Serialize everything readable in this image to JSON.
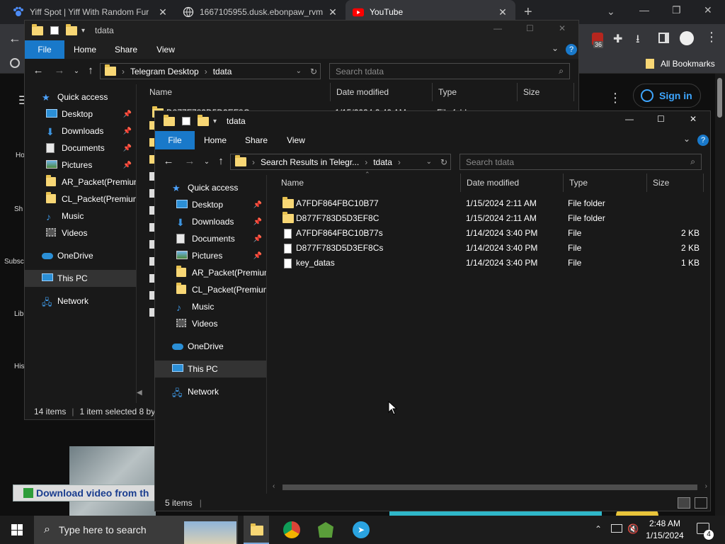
{
  "chrome": {
    "tabs": [
      {
        "title": "Yiff Spot | Yiff With Random Fur",
        "active": false
      },
      {
        "title": "1667105955.dusk.ebonpaw_rvm",
        "active": false
      },
      {
        "title": "YouTube",
        "active": true
      }
    ],
    "bookmarks_label": "All Bookmarks",
    "ext_badge": "36",
    "signin_label": "Sign in",
    "yt_sidebar": [
      "Ho",
      "Sh",
      "Subsc",
      "Lib",
      "His"
    ],
    "yt_banner": "Download video from th"
  },
  "back_explorer": {
    "title": "tdata",
    "ribbon": [
      "File",
      "Home",
      "Share",
      "View"
    ],
    "breadcrumb": [
      "Telegram Desktop",
      "tdata"
    ],
    "search_placeholder": "Search tdata",
    "columns": [
      "Name",
      "Date modified",
      "Type",
      "Size"
    ],
    "partial_row": {
      "name": "D877F783D5D3EF8C",
      "date": "1/15/2024 2:40 AM",
      "type": "File fold"
    },
    "nav": [
      {
        "label": "Quick access",
        "icon": "star"
      },
      {
        "label": "Desktop",
        "icon": "desktop",
        "pinned": true
      },
      {
        "label": "Downloads",
        "icon": "download",
        "pinned": true
      },
      {
        "label": "Documents",
        "icon": "documents",
        "pinned": true
      },
      {
        "label": "Pictures",
        "icon": "pictures",
        "pinned": true
      },
      {
        "label": "AR_Packet(Premium",
        "icon": "folder"
      },
      {
        "label": "CL_Packet(Premium",
        "icon": "folder"
      },
      {
        "label": "Music",
        "icon": "music"
      },
      {
        "label": "Videos",
        "icon": "videos"
      },
      {
        "label": "OneDrive",
        "icon": "cloud"
      },
      {
        "label": "This PC",
        "icon": "pc",
        "selected": true
      },
      {
        "label": "Network",
        "icon": "network"
      }
    ],
    "status": {
      "count": "14 items",
      "selected": "1 item selected  8 by"
    }
  },
  "front_explorer": {
    "title": "tdata",
    "ribbon": [
      "File",
      "Home",
      "Share",
      "View"
    ],
    "breadcrumb": [
      "Search Results in Telegr...",
      "tdata"
    ],
    "search_placeholder": "Search tdata",
    "columns": [
      "Name",
      "Date modified",
      "Type",
      "Size"
    ],
    "nav": [
      {
        "label": "Quick access",
        "icon": "star"
      },
      {
        "label": "Desktop",
        "icon": "desktop",
        "pinned": true
      },
      {
        "label": "Downloads",
        "icon": "download",
        "pinned": true
      },
      {
        "label": "Documents",
        "icon": "documents",
        "pinned": true
      },
      {
        "label": "Pictures",
        "icon": "pictures",
        "pinned": true
      },
      {
        "label": "AR_Packet(Premium",
        "icon": "folder"
      },
      {
        "label": "CL_Packet(Premium",
        "icon": "folder"
      },
      {
        "label": "Music",
        "icon": "music"
      },
      {
        "label": "Videos",
        "icon": "videos"
      },
      {
        "label": "OneDrive",
        "icon": "cloud"
      },
      {
        "label": "This PC",
        "icon": "pc",
        "selected": true
      },
      {
        "label": "Network",
        "icon": "network"
      }
    ],
    "files": [
      {
        "name": "A7FDF864FBC10B77",
        "date": "1/15/2024 2:11 AM",
        "type": "File folder",
        "size": "",
        "kind": "folder"
      },
      {
        "name": "D877F783D5D3EF8C",
        "date": "1/15/2024 2:11 AM",
        "type": "File folder",
        "size": "",
        "kind": "folder"
      },
      {
        "name": "A7FDF864FBC10B77s",
        "date": "1/14/2024 3:40 PM",
        "type": "File",
        "size": "2 KB",
        "kind": "file"
      },
      {
        "name": "D877F783D5D3EF8Cs",
        "date": "1/14/2024 3:40 PM",
        "type": "File",
        "size": "2 KB",
        "kind": "file"
      },
      {
        "name": "key_datas",
        "date": "1/14/2024 3:40 PM",
        "type": "File",
        "size": "1 KB",
        "kind": "file"
      }
    ],
    "status": {
      "count": "5 items"
    }
  },
  "taskbar": {
    "search_placeholder": "Type here to search",
    "time": "2:48 AM",
    "date": "1/15/2024",
    "notif_count": "4"
  },
  "colors": {
    "accent": "#1979ca",
    "folder": "#f8d775",
    "youtube_red": "#ff0000",
    "signin_blue": "#3ea6ff"
  }
}
